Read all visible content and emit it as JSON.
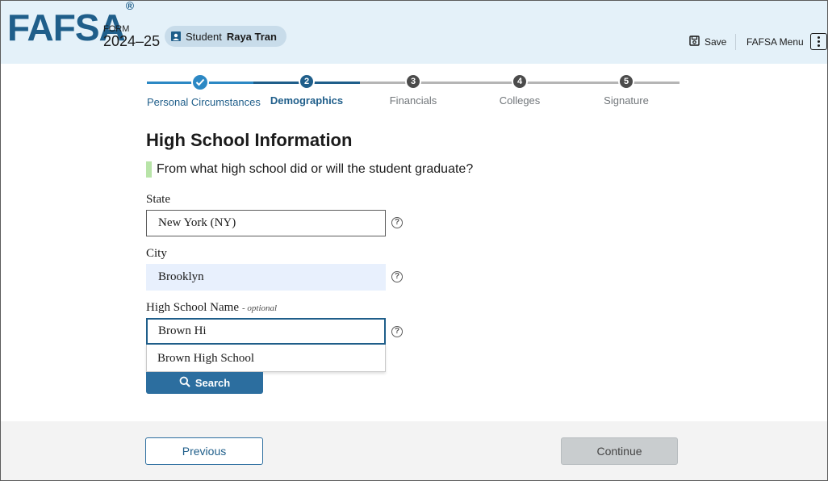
{
  "header": {
    "logo": "FAFSA",
    "logo_mark": "®",
    "form_label": "FORM",
    "form_year": "2024–25",
    "student_role": "Student",
    "student_name": "Raya Tran",
    "save_label": "Save",
    "menu_label": "FAFSA Menu"
  },
  "stepper": {
    "steps": [
      {
        "number": "1",
        "label": "Personal Circumstances",
        "status": "complete"
      },
      {
        "number": "2",
        "label": "Demographics",
        "status": "current"
      },
      {
        "number": "3",
        "label": "Financials",
        "status": "upcoming"
      },
      {
        "number": "4",
        "label": "Colleges",
        "status": "upcoming"
      },
      {
        "number": "5",
        "label": "Signature",
        "status": "upcoming"
      }
    ]
  },
  "main": {
    "title": "High School Information",
    "question": "From what high school did or will the student graduate?",
    "state": {
      "label": "State",
      "value": "New York (NY)"
    },
    "city": {
      "label": "City",
      "value": "Brooklyn"
    },
    "school": {
      "label": "High School Name",
      "optional": "- optional",
      "value": "Brown Hi"
    },
    "suggestions": [
      "Brown High School"
    ],
    "search_label": "Search",
    "help_glyph": "?"
  },
  "footer": {
    "previous_label": "Previous",
    "continue_label": "Continue"
  },
  "colors": {
    "brand": "#1f5e8a",
    "header_bg": "#e4f1f9",
    "accent_green": "#b8e4a8",
    "disabled": "#c9cdcf"
  }
}
